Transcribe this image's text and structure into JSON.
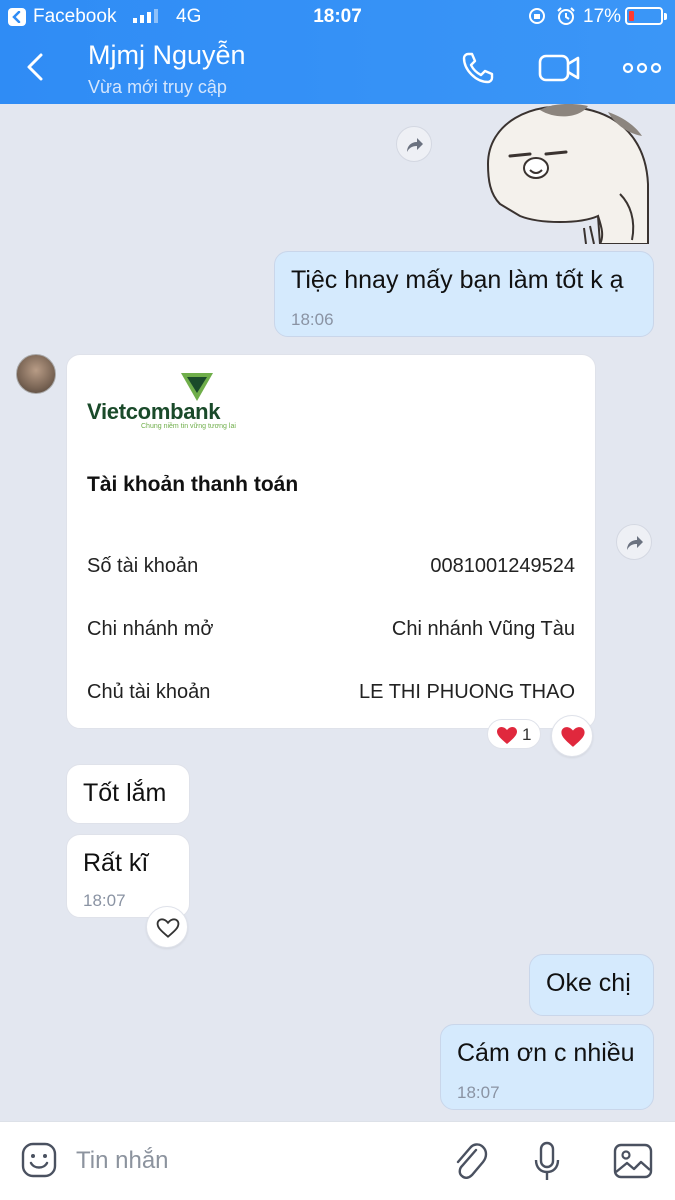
{
  "status_bar": {
    "app_back_label": "Facebook",
    "network": "4G",
    "time": "18:07",
    "battery_percent": "17%",
    "battery_level": 0.17,
    "battery_color": "#ff3b30"
  },
  "header": {
    "contact_name": "Mjmj Nguyễn",
    "contact_status": "Vừa mới truy cập",
    "accent_color": "#2f8cf5",
    "icons": [
      "back-arrow-icon",
      "phone-icon",
      "video-call-icon",
      "more-icon"
    ]
  },
  "messages": [
    {
      "id": "m1",
      "direction": "out",
      "type": "sticker",
      "sticker": "cat-sticker"
    },
    {
      "id": "m2",
      "direction": "out",
      "type": "text",
      "text": "Tiệc hnay mấy bạn làm tốt k ạ",
      "time": "18:06"
    },
    {
      "id": "m3",
      "direction": "in",
      "type": "bank_card",
      "card": {
        "bank_name": "Vietcombank",
        "bank_tagline": "Chung niềm tin vững tương lai",
        "title": "Tài khoản thanh toán",
        "rows": [
          {
            "label": "Số tài khoản",
            "value": "0081001249524"
          },
          {
            "label": "Chi nhánh mở",
            "value": "Chi nhánh Vũng Tàu"
          },
          {
            "label": "Chủ tài khoản",
            "value": "LE THI PHUONG THAO"
          }
        ]
      },
      "reaction": {
        "emoji": "heart",
        "count": "1"
      }
    },
    {
      "id": "m4",
      "direction": "in",
      "type": "text",
      "text": "Tốt lắm"
    },
    {
      "id": "m5",
      "direction": "in",
      "type": "text",
      "text": "Rất kĩ",
      "time": "18:07"
    },
    {
      "id": "m6",
      "direction": "out",
      "type": "text",
      "text": "Oke chị"
    },
    {
      "id": "m7",
      "direction": "out",
      "type": "text",
      "text": "Cám ơn c nhiều",
      "time": "18:07"
    }
  ],
  "composer": {
    "placeholder": "Tin nhắn",
    "icons": [
      "emoji-icon",
      "attach-icon",
      "mic-icon",
      "image-icon"
    ]
  },
  "colors": {
    "chat_background": "#e3e7f0",
    "outgoing_bubble": "#d5eafd",
    "incoming_bubble": "#ffffff",
    "heart": "#e0283d"
  }
}
